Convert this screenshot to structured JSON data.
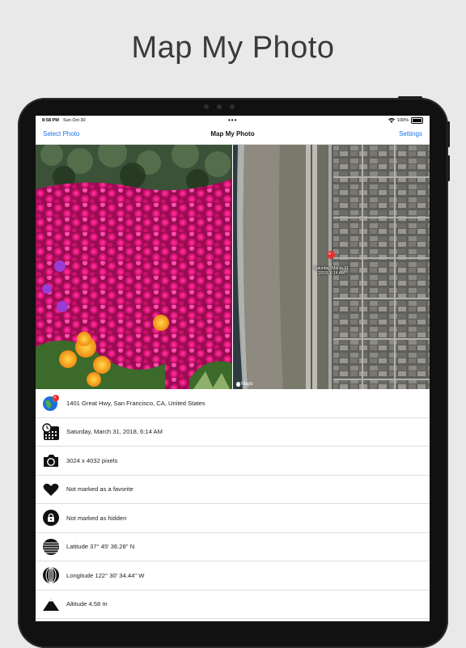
{
  "headline": "Map My Photo",
  "status_bar": {
    "time": "8:58 PM",
    "date": "Sun Oct 30",
    "battery": "100%"
  },
  "nav": {
    "left_label": "Select Photo",
    "title": "Map My Photo",
    "right_label": "Settings"
  },
  "map": {
    "pin_label": "Saturday, March 31, 2018, 6:14 AM",
    "attribution": "Maps"
  },
  "details": [
    {
      "icon": "globe-icon",
      "text": "1401 Great Hwy, San Francisco, CA, United States"
    },
    {
      "icon": "calendar-clock-icon",
      "text": "Saturday, March 31, 2018, 6:14 AM"
    },
    {
      "icon": "camera-icon",
      "text": "3024 x 4032 pixels"
    },
    {
      "icon": "heart-icon",
      "text": "Not marked as a favorite"
    },
    {
      "icon": "lock-icon",
      "text": "Not marked as hidden"
    },
    {
      "icon": "latitude-icon",
      "text": "Latitude 37° 45' 36.28'' N"
    },
    {
      "icon": "longitude-icon",
      "text": "Longitude 122° 30' 34.44'' W"
    },
    {
      "icon": "mountain-icon",
      "text": "Altitude 4.58 m"
    }
  ],
  "colors": {
    "accent": "#1a73e8",
    "background": "#e9e9e9"
  }
}
